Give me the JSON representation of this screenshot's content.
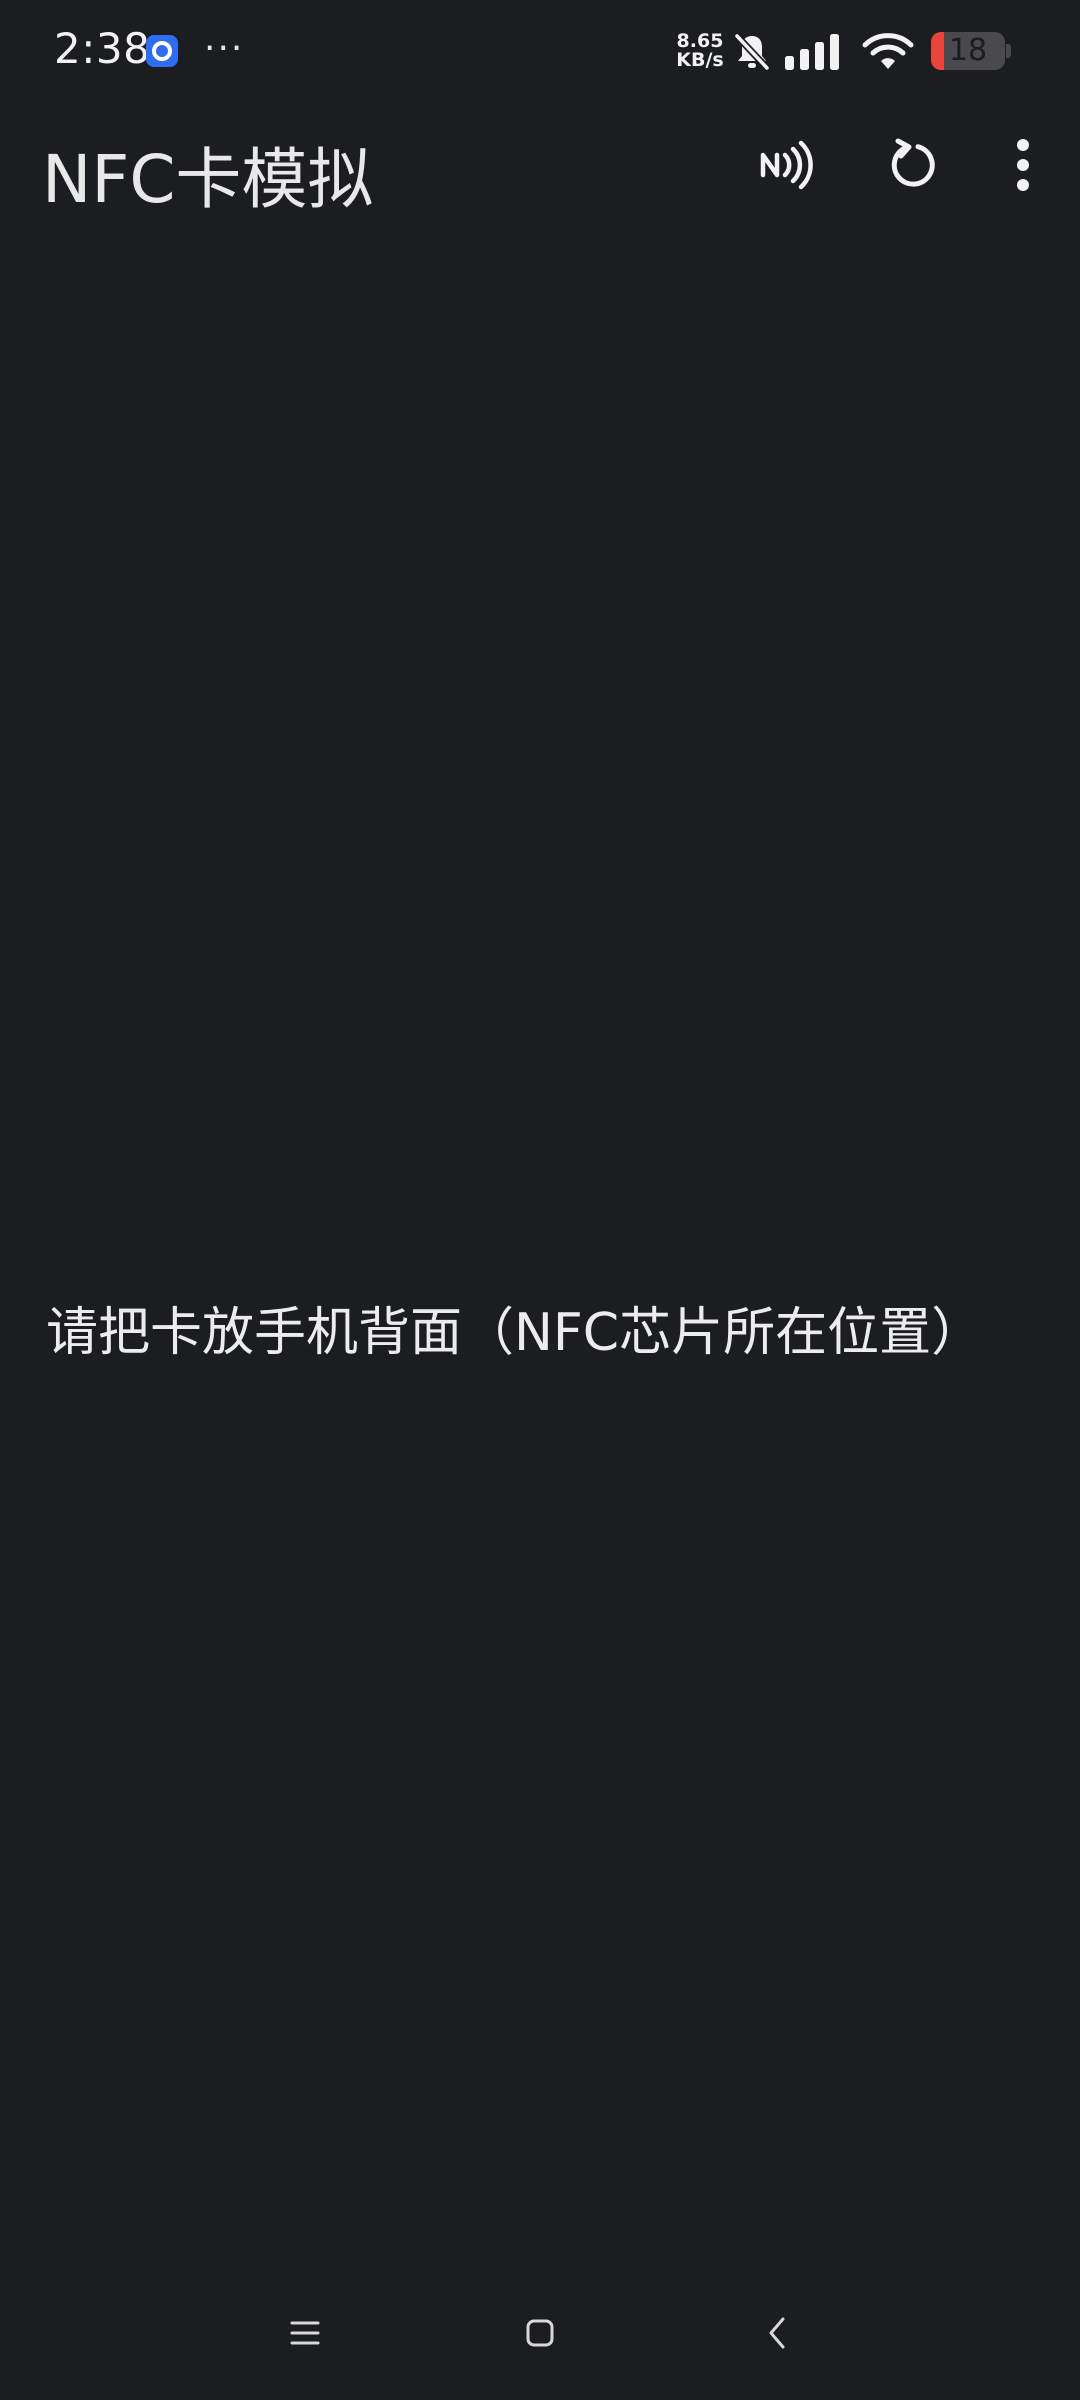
{
  "status_bar": {
    "time": "2:38",
    "overflow": "···",
    "net_speed_value": "8.65",
    "net_speed_unit": "KB/s",
    "battery_level": "18",
    "battery_fraction": 0.18,
    "icons": [
      "app-notification-icon",
      "bell-muted-icon",
      "cellular-signal-icon",
      "wifi-icon",
      "battery-icon"
    ]
  },
  "app_bar": {
    "title": "NFC卡模拟",
    "actions": [
      "nfc-icon",
      "refresh-icon",
      "more-vert-icon"
    ]
  },
  "main": {
    "message": "请把卡放手机背面（NFC芯片所在位置）"
  },
  "nav_bar": {
    "buttons": [
      "recents-menu-icon",
      "home-square-icon",
      "back-chevron-icon"
    ]
  },
  "colors": {
    "background": "#1c1d20",
    "text": "#e8e8e8",
    "battery_low": "#e8443a",
    "app_icon_blue": "#2f6df0"
  }
}
